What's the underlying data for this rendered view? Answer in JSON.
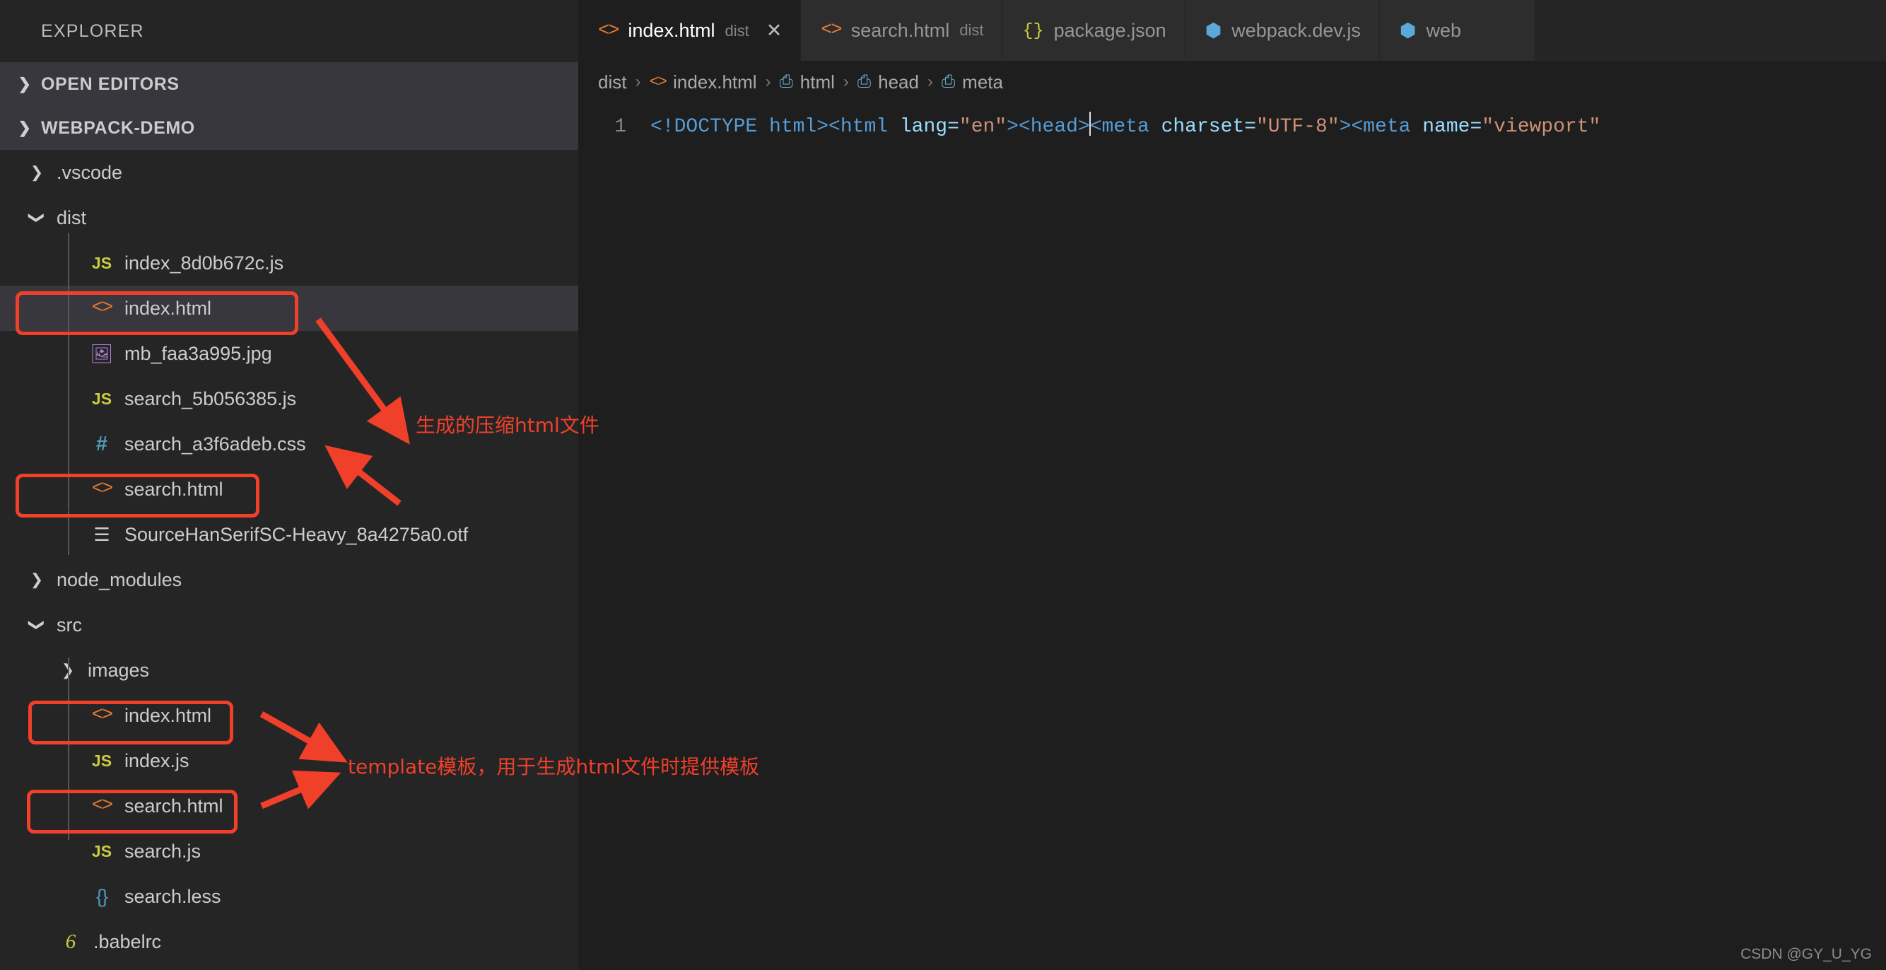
{
  "sidebar": {
    "title": "EXPLORER",
    "sections": [
      {
        "label": "OPEN EDITORS",
        "expanded": false
      },
      {
        "label": "WEBPACK-DEMO",
        "expanded": true
      }
    ],
    "tree": [
      {
        "label": ".vscode",
        "icon": "folder",
        "depth": 1,
        "twisty": "collapsed",
        "selected": false,
        "boxed": false
      },
      {
        "label": "dist",
        "icon": "folder",
        "depth": 1,
        "twisty": "expanded",
        "selected": false,
        "boxed": false
      },
      {
        "label": "index_8d0b672c.js",
        "icon": "js",
        "depth": 2,
        "twisty": "none",
        "selected": false,
        "boxed": false
      },
      {
        "label": "index.html",
        "icon": "html",
        "depth": 2,
        "twisty": "none",
        "selected": true,
        "boxed": true
      },
      {
        "label": "mb_faa3a995.jpg",
        "icon": "image",
        "depth": 2,
        "twisty": "none",
        "selected": false,
        "boxed": false
      },
      {
        "label": "search_5b056385.js",
        "icon": "js",
        "depth": 2,
        "twisty": "none",
        "selected": false,
        "boxed": false
      },
      {
        "label": "search_a3f6adeb.css",
        "icon": "css",
        "depth": 2,
        "twisty": "none",
        "selected": false,
        "boxed": false
      },
      {
        "label": "search.html",
        "icon": "html",
        "depth": 2,
        "twisty": "none",
        "selected": false,
        "boxed": true
      },
      {
        "label": "SourceHanSerifSC-Heavy_8a4275a0.otf",
        "icon": "font",
        "depth": 2,
        "twisty": "none",
        "selected": false,
        "boxed": false
      },
      {
        "label": "node_modules",
        "icon": "folder",
        "depth": 1,
        "twisty": "collapsed",
        "selected": false,
        "boxed": false
      },
      {
        "label": "src",
        "icon": "folder",
        "depth": 1,
        "twisty": "expanded",
        "selected": false,
        "boxed": false
      },
      {
        "label": "images",
        "icon": "folder",
        "depth": 2,
        "twisty": "collapsed",
        "selected": false,
        "boxed": false
      },
      {
        "label": "index.html",
        "icon": "html",
        "depth": 2,
        "twisty": "none",
        "selected": false,
        "boxed": true
      },
      {
        "label": "index.js",
        "icon": "js",
        "depth": 2,
        "twisty": "none",
        "selected": false,
        "boxed": false
      },
      {
        "label": "search.html",
        "icon": "html",
        "depth": 2,
        "twisty": "none",
        "selected": false,
        "boxed": true
      },
      {
        "label": "search.js",
        "icon": "js",
        "depth": 2,
        "twisty": "none",
        "selected": false,
        "boxed": false
      },
      {
        "label": "search.less",
        "icon": "less",
        "depth": 2,
        "twisty": "none",
        "selected": false,
        "boxed": false
      },
      {
        "label": ".babelrc",
        "icon": "babel",
        "depth": 1,
        "twisty": "none",
        "selected": false,
        "boxed": false
      }
    ]
  },
  "tabs": [
    {
      "name": "index.html",
      "desc": "dist",
      "icon": "html",
      "active": true,
      "close": "✕"
    },
    {
      "name": "search.html",
      "desc": "dist",
      "icon": "html",
      "active": false,
      "close": ""
    },
    {
      "name": "package.json",
      "desc": "",
      "icon": "json",
      "active": false,
      "close": ""
    },
    {
      "name": "webpack.dev.js",
      "desc": "",
      "icon": "webpack",
      "active": false,
      "close": ""
    },
    {
      "name": "web",
      "desc": "",
      "icon": "webpack",
      "active": false,
      "close": ""
    }
  ],
  "breadcrumb": [
    {
      "label": "dist",
      "icon": "none"
    },
    {
      "label": "index.html",
      "icon": "html"
    },
    {
      "label": "html",
      "icon": "tag"
    },
    {
      "label": "head",
      "icon": "tag"
    },
    {
      "label": "meta",
      "icon": "tag"
    }
  ],
  "code": {
    "line_number": "1",
    "tokens": [
      {
        "t": "<!DOCTYPE html>",
        "c": "c-comment"
      },
      {
        "t": "<html",
        "c": "c-tag"
      },
      {
        "t": " lang=",
        "c": "c-attr"
      },
      {
        "t": "\"en\"",
        "c": "c-str"
      },
      {
        "t": ">",
        "c": "c-tag"
      },
      {
        "t": "<head>",
        "c": "c-tag"
      },
      {
        "t": "<meta",
        "c": "c-tag"
      },
      {
        "t": " charset=",
        "c": "c-attr"
      },
      {
        "t": "\"UTF-8\"",
        "c": "c-str"
      },
      {
        "t": ">",
        "c": "c-tag"
      },
      {
        "t": "<meta",
        "c": "c-tag"
      },
      {
        "t": " name=",
        "c": "c-attr"
      },
      {
        "t": "\"viewport\"",
        "c": "c-str"
      }
    ]
  },
  "annotations": [
    {
      "text": "生成的压缩html文件"
    },
    {
      "text": "template模板，用于生成html文件时提供模板"
    }
  ],
  "watermark": "CSDN @GY_U_YG",
  "colors": {
    "annotation": "#f0402a",
    "selection": "#37373d",
    "editor_bg": "#1e1e1e",
    "sidebar_bg": "#252526",
    "js_icon": "#cbcb41",
    "html_icon": "#e37933",
    "css_icon": "#519aba",
    "image_icon": "#b180d7"
  }
}
